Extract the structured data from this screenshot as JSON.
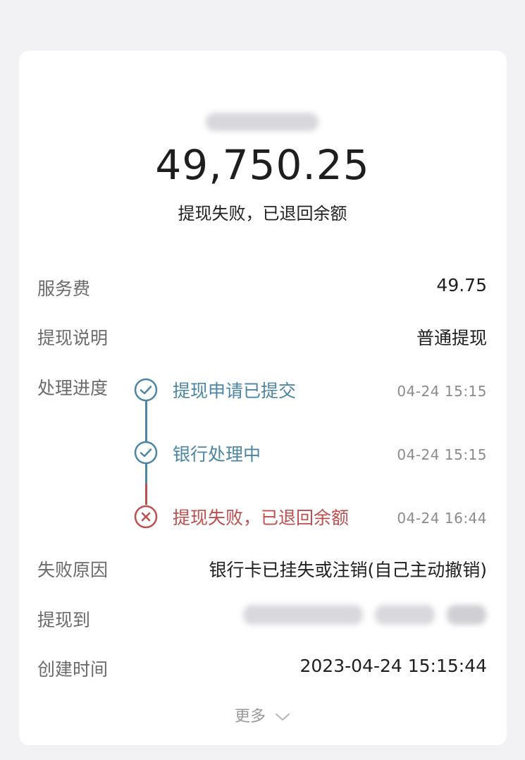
{
  "amount": "49,750.25",
  "status_text": "提现失败，已退回余额",
  "details": {
    "service_fee": {
      "label": "服务费",
      "value": "49.75"
    },
    "withdraw_note": {
      "label": "提现说明",
      "value": "普通提现"
    },
    "progress_label": "处理进度",
    "fail_reason": {
      "label": "失败原因",
      "value": "银行卡已挂失或注销(自己主动撤销)"
    },
    "withdraw_to": {
      "label": "提现到"
    },
    "created_time": {
      "label": "创建时间",
      "value": "2023-04-24 15:15:44"
    }
  },
  "progress": [
    {
      "label": "提现申请已提交",
      "time": "04-24 15:15",
      "state": "done"
    },
    {
      "label": "银行处理中",
      "time": "04-24 15:15",
      "state": "done"
    },
    {
      "label": "提现失败，已退回余额",
      "time": "04-24 16:44",
      "state": "failed"
    }
  ],
  "colors": {
    "done": "#4b86a6",
    "failed": "#c04e4e"
  },
  "icons": {
    "done": "check-circle-icon",
    "failed": "x-circle-icon",
    "more": "chevron-down-icon"
  },
  "more_label": "更多"
}
